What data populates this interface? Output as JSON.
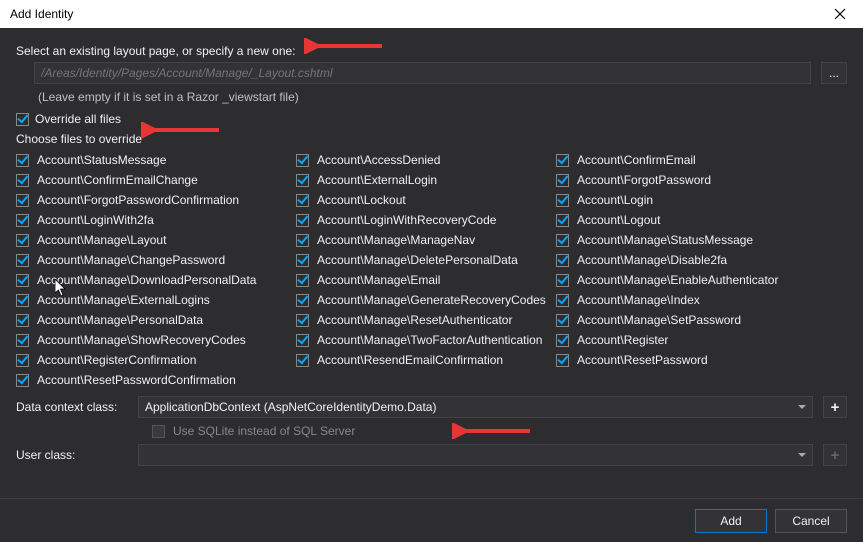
{
  "title": "Add Identity",
  "layout_section_label": "Select an existing layout page, or specify a new one:",
  "layout_placeholder": "/Areas/Identity/Pages/Account/Manage/_Layout.cshtml",
  "layout_hint": "(Leave empty if it is set in a Razor _viewstart file)",
  "override_label": "Override all files",
  "choose_label": "Choose files to override",
  "files": {
    "col1": [
      "Account\\StatusMessage",
      "Account\\ConfirmEmailChange",
      "Account\\ForgotPasswordConfirmation",
      "Account\\LoginWith2fa",
      "Account\\Manage\\Layout",
      "Account\\Manage\\ChangePassword",
      "Account\\Manage\\DownloadPersonalData",
      "Account\\Manage\\ExternalLogins",
      "Account\\Manage\\PersonalData",
      "Account\\Manage\\ShowRecoveryCodes",
      "Account\\RegisterConfirmation",
      "Account\\ResetPasswordConfirmation"
    ],
    "col2": [
      "Account\\AccessDenied",
      "Account\\ExternalLogin",
      "Account\\Lockout",
      "Account\\LoginWithRecoveryCode",
      "Account\\Manage\\ManageNav",
      "Account\\Manage\\DeletePersonalData",
      "Account\\Manage\\Email",
      "Account\\Manage\\GenerateRecoveryCodes",
      "Account\\Manage\\ResetAuthenticator",
      "Account\\Manage\\TwoFactorAuthentication",
      "Account\\ResendEmailConfirmation"
    ],
    "col3": [
      "Account\\ConfirmEmail",
      "Account\\ForgotPassword",
      "Account\\Login",
      "Account\\Logout",
      "Account\\Manage\\StatusMessage",
      "Account\\Manage\\Disable2fa",
      "Account\\Manage\\EnableAuthenticator",
      "Account\\Manage\\Index",
      "Account\\Manage\\SetPassword",
      "Account\\Register",
      "Account\\ResetPassword"
    ]
  },
  "data_context_label": "Data context class:",
  "data_context_value": "ApplicationDbContext (AspNetCoreIdentityDemo.Data)",
  "sqlite_label": "Use SQLite instead of SQL Server",
  "user_class_label": "User class:",
  "add_button": "Add",
  "cancel_button": "Cancel",
  "browse_ellipsis": "..."
}
